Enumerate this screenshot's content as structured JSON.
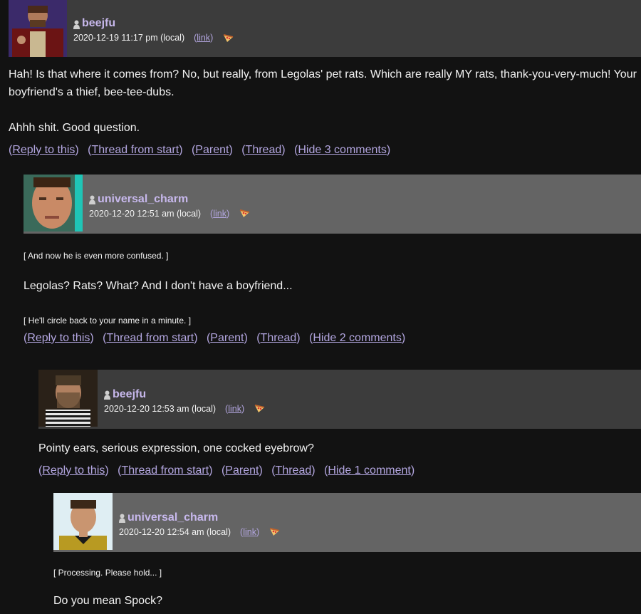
{
  "comments": [
    {
      "username": "beejfu",
      "date": "2020-12-19 11:17 pm (local)",
      "link": "link",
      "paragraphs": [
        "Hah! Is that where it comes from? No, but really, from Legolas' pet rats. Which are really MY rats, thank-you-very-much! Your boyfriend's a thief, bee-tee-dubs.",
        "Ahhh shit. Good question."
      ],
      "actions": [
        "Reply to this",
        "Thread from start",
        "Parent",
        "Thread",
        "Hide 3 comments"
      ]
    },
    {
      "username": "universal_charm",
      "date": "2020-12-20 12:51 am (local)",
      "link": "link",
      "note1": "[ And now he is even more confused. ]",
      "line": "Legolas? Rats? What? And I don't have a boyfriend...",
      "note2": "[ He'll circle back to your name in a minute. ]",
      "actions": [
        "Reply to this",
        "Thread from start",
        "Parent",
        "Thread",
        "Hide 2 comments"
      ]
    },
    {
      "username": "beejfu",
      "date": "2020-12-20 12:53 am (local)",
      "link": "link",
      "line": "Pointy ears, serious expression, one cocked eyebrow?",
      "actions": [
        "Reply to this",
        "Thread from start",
        "Parent",
        "Thread",
        "Hide 1 comment"
      ]
    },
    {
      "username": "universal_charm",
      "date": "2020-12-20 12:54 am (local)",
      "link": "link",
      "note1": "[ Processing. Please hold... ]",
      "line": "Do you mean Spock?"
    }
  ],
  "colors": {
    "page_bg": "#121212",
    "header_bg_1": "#3c3c3c",
    "header_bg_2": "#646464",
    "username": "#c7b8ec",
    "link": "#b3a6e0"
  },
  "icons": {
    "user": "user-icon",
    "mood": "pizza-icon"
  }
}
